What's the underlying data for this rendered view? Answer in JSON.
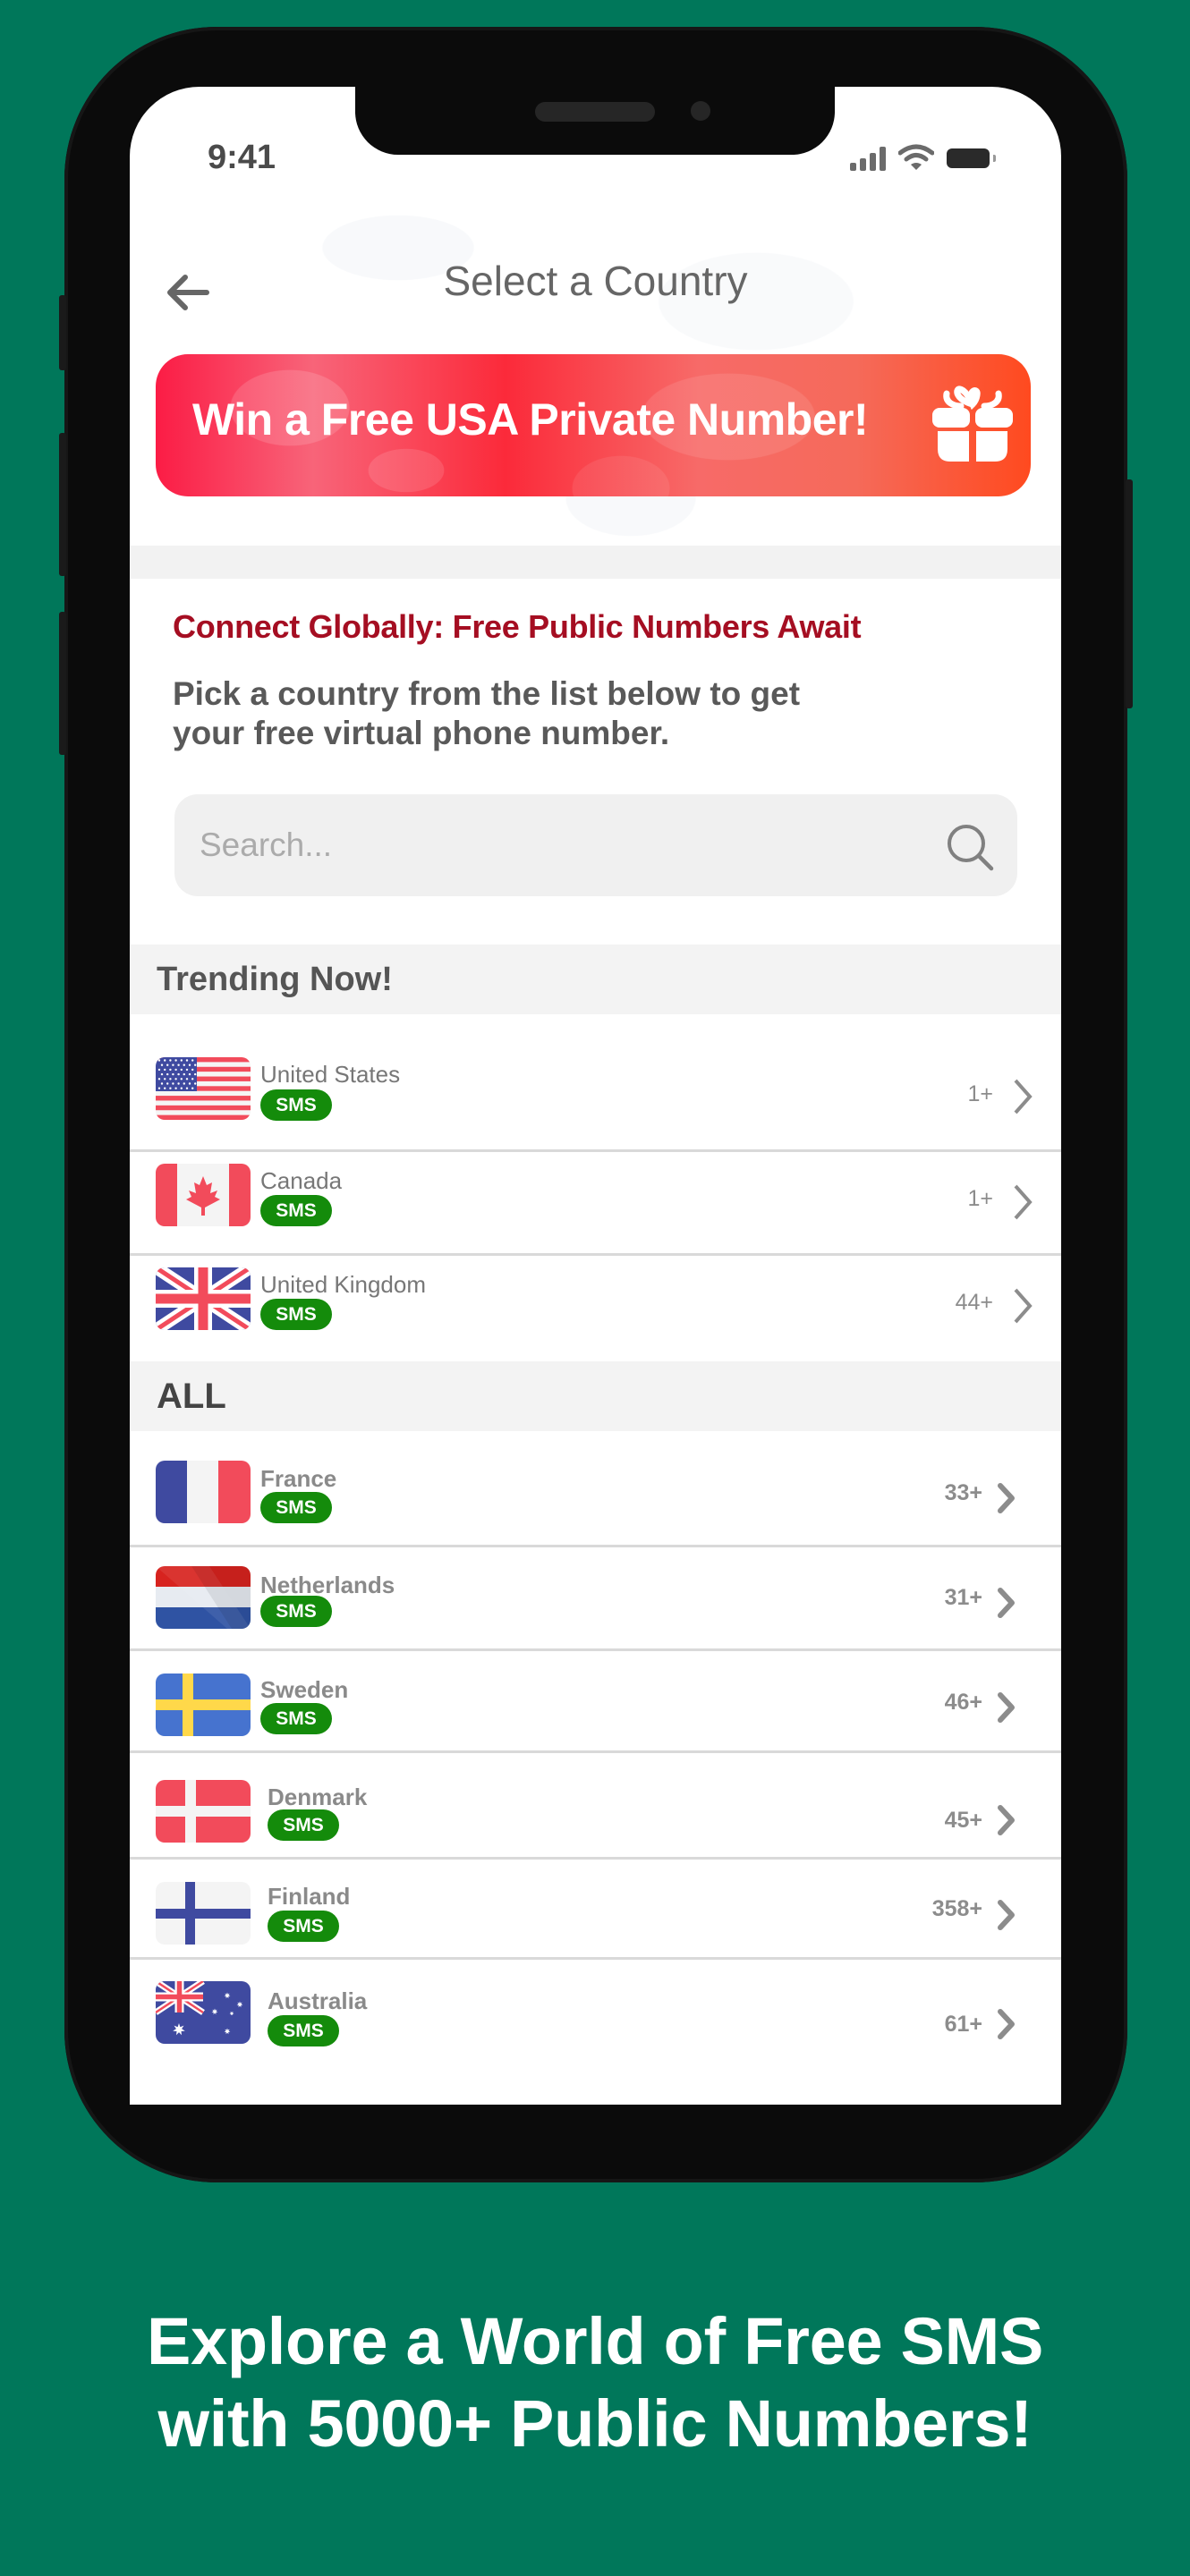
{
  "status_bar": {
    "time": "9:41"
  },
  "header": {
    "title": "Select a Country",
    "back_icon": "arrow-left-icon"
  },
  "banner": {
    "text": "Win a Free USA Private Number!",
    "icon": "gift-icon",
    "gradient_start": "#fb1c45",
    "gradient_end": "#ff4a1f"
  },
  "promo": {
    "heading": "Connect Globally: Free Public Numbers Await",
    "description": "Pick a country from the list below to get your free virtual phone number."
  },
  "search": {
    "placeholder": "Search...",
    "value": "",
    "icon": "search-icon"
  },
  "trending": {
    "title": "Trending Now!",
    "items": [
      {
        "name": "United States",
        "badge": "SMS",
        "count": "1+",
        "flag": "us-flag"
      },
      {
        "name": "Canada",
        "badge": "SMS",
        "count": "1+",
        "flag": "ca-flag"
      },
      {
        "name": "United Kingdom",
        "badge": "SMS",
        "count": "44+",
        "flag": "gb-flag"
      }
    ]
  },
  "all": {
    "title": "ALL",
    "items": [
      {
        "name": "France",
        "badge": "SMS",
        "count": "33+",
        "flag": "fr-flag"
      },
      {
        "name": "Netherlands",
        "badge": "SMS",
        "count": "31+",
        "flag": "nl-flag"
      },
      {
        "name": "Sweden",
        "badge": "SMS",
        "count": "46+",
        "flag": "se-flag"
      },
      {
        "name": "Denmark",
        "badge": "SMS",
        "count": "45+",
        "flag": "dk-flag"
      },
      {
        "name": "Finland",
        "badge": "SMS",
        "count": "358+",
        "flag": "fi-flag"
      },
      {
        "name": "Australia",
        "badge": "SMS",
        "count": "61+",
        "flag": "au-flag"
      }
    ]
  },
  "caption": {
    "line1": "Explore a World of Free SMS",
    "line2": "with 5000+ Public Numbers!"
  },
  "colors": {
    "background": "#00775a",
    "sms_badge": "#148b0b",
    "heading_red": "#a50e22"
  }
}
